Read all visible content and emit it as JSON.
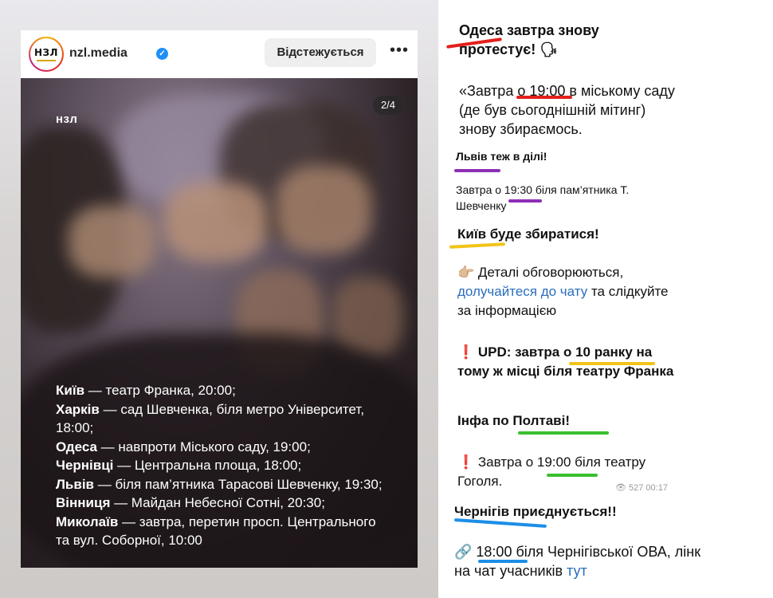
{
  "instagram": {
    "avatar_text": "НЗЛ",
    "username": "nzl.media",
    "verified_icon": "verified-badge-icon",
    "follow_label": "Відстежується",
    "more_icon": "more-dots-icon",
    "more_glyph": "•••",
    "page_counter": "2/4",
    "brand": "нзл",
    "cities": [
      {
        "city": "Київ",
        "detail": " — театр Франка, 20:00;"
      },
      {
        "city": "Харків",
        "detail": " — сад Шевченка, біля метро Університет, 18:00;"
      },
      {
        "city": "Одеса",
        "detail": " — навпроти Міського саду, 19:00;"
      },
      {
        "city": "Чернівці",
        "detail": " — Центральна площа, 18:00;"
      },
      {
        "city": "Львів",
        "detail": " — біля пам’ятника Тарасові Шевченку, 19:30;"
      },
      {
        "city": "Вінниця",
        "detail": " — Майдан Небесної Сотні, 20:30;"
      },
      {
        "city": "Миколаїв",
        "detail": " — завтра, перетин просп. Центрального та вул. Соборної, 10:00"
      }
    ]
  },
  "chat": {
    "odesa": {
      "title": "Одеса завтра знову протестує! 🗣",
      "body": "«Завтра о 19:00 в міському саду (де був сьогоднішній мітинг) знову збираємось."
    },
    "lviv": {
      "title": "Львів теж в ділі!",
      "body": "Завтра о 19:30 біля пам’ятника Т. Шевченку"
    },
    "kyiv": {
      "title": "Київ буде збиратися!",
      "body_pre": "👉🏼 Деталі обговорюються, ",
      "body_link": "долучайтеся до чату",
      "body_post": " та слідкуйте за інформацією",
      "update": "❗ UPD: завтра о 10 ранку на тому ж місці біля театру Франка"
    },
    "poltava": {
      "title": "Інфа по Полтаві!",
      "body": "❗ Завтра о 19:00 біля театру Гоголя.",
      "views": "👁 527 00:17"
    },
    "chernihiv": {
      "title": "Чернігів приєднується!!",
      "body_pre": "🔗 18:00 біля Чернігівської ОВА, лінк на чат учасників ",
      "body_link": "тут"
    },
    "colors": {
      "red": "#e3201b",
      "purple": "#8e2fb5",
      "yellow": "#f0c419",
      "green": "#3bbf2f",
      "blue": "#1b8ee8",
      "link": "#2a6ebb"
    }
  }
}
